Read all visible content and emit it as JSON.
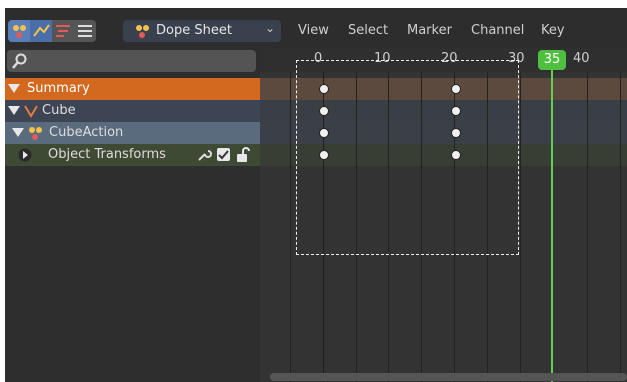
{
  "header": {
    "editor_type": "Dope Sheet",
    "menus": [
      "View",
      "Select",
      "Marker",
      "Channel",
      "Key"
    ]
  },
  "channels": {
    "search_placeholder": "",
    "rows": [
      {
        "label": "Summary"
      },
      {
        "label": "Cube"
      },
      {
        "label": "CubeAction"
      },
      {
        "label": "Object Transforms"
      }
    ]
  },
  "timeline": {
    "frame_labels": [
      "0",
      "10",
      "20",
      "30",
      "40"
    ],
    "current_frame": "35"
  },
  "colors": {
    "summary_row": "#d2691e",
    "cube_row": "#3d4554",
    "action_row": "#5a6b7e",
    "group_row": "#3f4a35",
    "playhead": "#61d04f"
  }
}
